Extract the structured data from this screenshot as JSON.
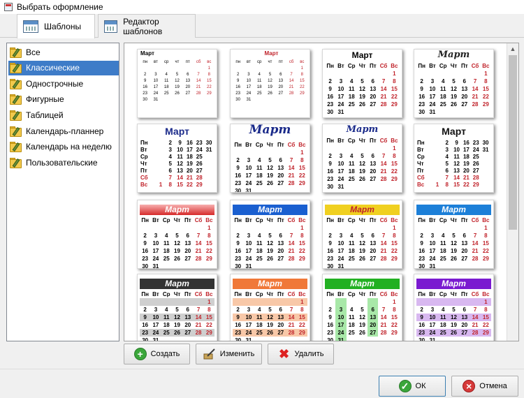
{
  "window": {
    "title": "Выбрать оформление"
  },
  "tabs": [
    {
      "label": "Шаблоны"
    },
    {
      "label": "Редактор шаблонов"
    }
  ],
  "categories": [
    "Все",
    "Классические",
    "Однострочные",
    "Фигурные",
    "Таблицей",
    "Календарь-планнер",
    "Календарь на неделю",
    "Пользовательские"
  ],
  "selected_category": "Классические",
  "month": "Март",
  "weekdays": [
    "Пн",
    "Вт",
    "Ср",
    "Чт",
    "Пт",
    "Сб",
    "Вс"
  ],
  "weekdays_small": [
    "пн",
    "вт",
    "ср",
    "чт",
    "пт",
    "сб",
    "вс"
  ],
  "template_colors": {
    "red": "#d62a2a",
    "blue": "#1a5fd0",
    "yellow": "#f0d020",
    "sky": "#1c7fd8",
    "black": "#333333",
    "orange": "#f07838",
    "green": "#22b022",
    "purple": "#7a1ad0"
  },
  "buttons": {
    "create": "Создать",
    "edit": "Изменить",
    "delete": "Удалить",
    "ok": "ОК",
    "cancel": "Отмена"
  }
}
